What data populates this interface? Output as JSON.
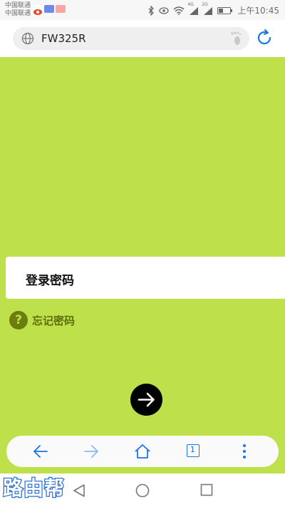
{
  "status_bar": {
    "carrier_1": "中国联通",
    "carrier_2": "中国联通",
    "network_1": "4G",
    "network_2": "2G",
    "time": "上午10:45"
  },
  "address_bar": {
    "url": "FW325R"
  },
  "login": {
    "password_label": "登录密码",
    "forgot_password": "忘记密码"
  },
  "toolbar": {
    "tab_count": "1"
  },
  "colors": {
    "page_background": "#bee04a",
    "accent": "#1a73e8"
  },
  "watermark_text": "路由帮"
}
